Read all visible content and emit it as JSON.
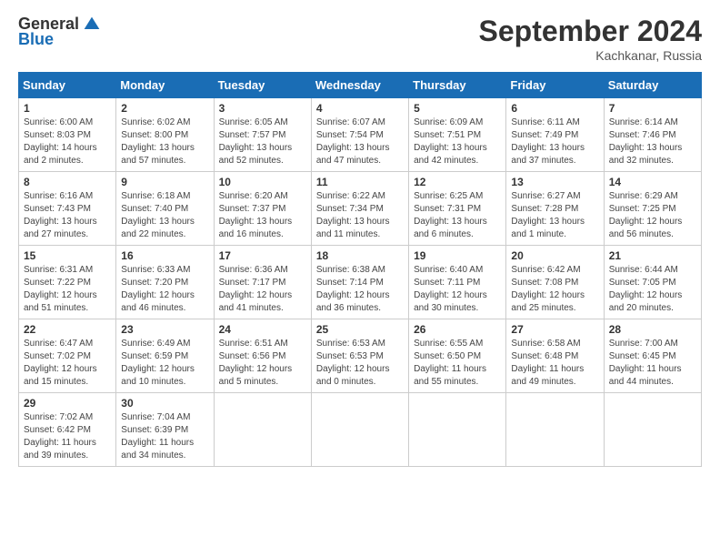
{
  "header": {
    "logo_general": "General",
    "logo_blue": "Blue",
    "month_title": "September 2024",
    "location": "Kachkanar, Russia"
  },
  "weekdays": [
    "Sunday",
    "Monday",
    "Tuesday",
    "Wednesday",
    "Thursday",
    "Friday",
    "Saturday"
  ],
  "weeks": [
    [
      {
        "day": "1",
        "info": "Sunrise: 6:00 AM\nSunset: 8:03 PM\nDaylight: 14 hours\nand 2 minutes."
      },
      {
        "day": "2",
        "info": "Sunrise: 6:02 AM\nSunset: 8:00 PM\nDaylight: 13 hours\nand 57 minutes."
      },
      {
        "day": "3",
        "info": "Sunrise: 6:05 AM\nSunset: 7:57 PM\nDaylight: 13 hours\nand 52 minutes."
      },
      {
        "day": "4",
        "info": "Sunrise: 6:07 AM\nSunset: 7:54 PM\nDaylight: 13 hours\nand 47 minutes."
      },
      {
        "day": "5",
        "info": "Sunrise: 6:09 AM\nSunset: 7:51 PM\nDaylight: 13 hours\nand 42 minutes."
      },
      {
        "day": "6",
        "info": "Sunrise: 6:11 AM\nSunset: 7:49 PM\nDaylight: 13 hours\nand 37 minutes."
      },
      {
        "day": "7",
        "info": "Sunrise: 6:14 AM\nSunset: 7:46 PM\nDaylight: 13 hours\nand 32 minutes."
      }
    ],
    [
      {
        "day": "8",
        "info": "Sunrise: 6:16 AM\nSunset: 7:43 PM\nDaylight: 13 hours\nand 27 minutes."
      },
      {
        "day": "9",
        "info": "Sunrise: 6:18 AM\nSunset: 7:40 PM\nDaylight: 13 hours\nand 22 minutes."
      },
      {
        "day": "10",
        "info": "Sunrise: 6:20 AM\nSunset: 7:37 PM\nDaylight: 13 hours\nand 16 minutes."
      },
      {
        "day": "11",
        "info": "Sunrise: 6:22 AM\nSunset: 7:34 PM\nDaylight: 13 hours\nand 11 minutes."
      },
      {
        "day": "12",
        "info": "Sunrise: 6:25 AM\nSunset: 7:31 PM\nDaylight: 13 hours\nand 6 minutes."
      },
      {
        "day": "13",
        "info": "Sunrise: 6:27 AM\nSunset: 7:28 PM\nDaylight: 13 hours\nand 1 minute."
      },
      {
        "day": "14",
        "info": "Sunrise: 6:29 AM\nSunset: 7:25 PM\nDaylight: 12 hours\nand 56 minutes."
      }
    ],
    [
      {
        "day": "15",
        "info": "Sunrise: 6:31 AM\nSunset: 7:22 PM\nDaylight: 12 hours\nand 51 minutes."
      },
      {
        "day": "16",
        "info": "Sunrise: 6:33 AM\nSunset: 7:20 PM\nDaylight: 12 hours\nand 46 minutes."
      },
      {
        "day": "17",
        "info": "Sunrise: 6:36 AM\nSunset: 7:17 PM\nDaylight: 12 hours\nand 41 minutes."
      },
      {
        "day": "18",
        "info": "Sunrise: 6:38 AM\nSunset: 7:14 PM\nDaylight: 12 hours\nand 36 minutes."
      },
      {
        "day": "19",
        "info": "Sunrise: 6:40 AM\nSunset: 7:11 PM\nDaylight: 12 hours\nand 30 minutes."
      },
      {
        "day": "20",
        "info": "Sunrise: 6:42 AM\nSunset: 7:08 PM\nDaylight: 12 hours\nand 25 minutes."
      },
      {
        "day": "21",
        "info": "Sunrise: 6:44 AM\nSunset: 7:05 PM\nDaylight: 12 hours\nand 20 minutes."
      }
    ],
    [
      {
        "day": "22",
        "info": "Sunrise: 6:47 AM\nSunset: 7:02 PM\nDaylight: 12 hours\nand 15 minutes."
      },
      {
        "day": "23",
        "info": "Sunrise: 6:49 AM\nSunset: 6:59 PM\nDaylight: 12 hours\nand 10 minutes."
      },
      {
        "day": "24",
        "info": "Sunrise: 6:51 AM\nSunset: 6:56 PM\nDaylight: 12 hours\nand 5 minutes."
      },
      {
        "day": "25",
        "info": "Sunrise: 6:53 AM\nSunset: 6:53 PM\nDaylight: 12 hours\nand 0 minutes."
      },
      {
        "day": "26",
        "info": "Sunrise: 6:55 AM\nSunset: 6:50 PM\nDaylight: 11 hours\nand 55 minutes."
      },
      {
        "day": "27",
        "info": "Sunrise: 6:58 AM\nSunset: 6:48 PM\nDaylight: 11 hours\nand 49 minutes."
      },
      {
        "day": "28",
        "info": "Sunrise: 7:00 AM\nSunset: 6:45 PM\nDaylight: 11 hours\nand 44 minutes."
      }
    ],
    [
      {
        "day": "29",
        "info": "Sunrise: 7:02 AM\nSunset: 6:42 PM\nDaylight: 11 hours\nand 39 minutes."
      },
      {
        "day": "30",
        "info": "Sunrise: 7:04 AM\nSunset: 6:39 PM\nDaylight: 11 hours\nand 34 minutes."
      },
      {
        "day": "",
        "info": ""
      },
      {
        "day": "",
        "info": ""
      },
      {
        "day": "",
        "info": ""
      },
      {
        "day": "",
        "info": ""
      },
      {
        "day": "",
        "info": ""
      }
    ]
  ]
}
